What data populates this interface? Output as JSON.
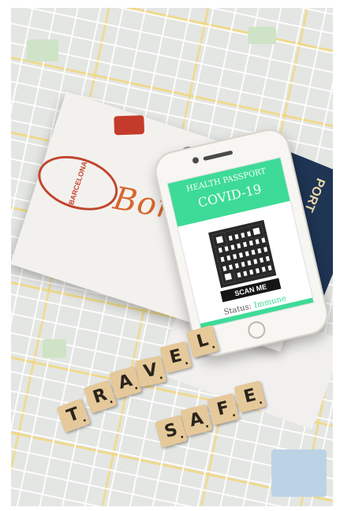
{
  "phone": {
    "header_small": "HEALTH PASSPORT",
    "header_big": "COVID-19",
    "scan_label": "SCAN ME",
    "status_label": "Status:",
    "status_value": "Immune"
  },
  "brochure": {
    "stamp_text": "BARCELONA",
    "script_text": "Bon voyage"
  },
  "passport_cover": {
    "word": "PORT"
  },
  "tiles": {
    "travel": [
      "T",
      "R",
      "A",
      "V",
      "E",
      "L"
    ],
    "safe": [
      "S",
      "A",
      "F",
      "E"
    ]
  },
  "colors": {
    "screen_green": "#3ddb97",
    "tile_wood": "#e6c99a",
    "passport_navy": "#1f3554"
  }
}
